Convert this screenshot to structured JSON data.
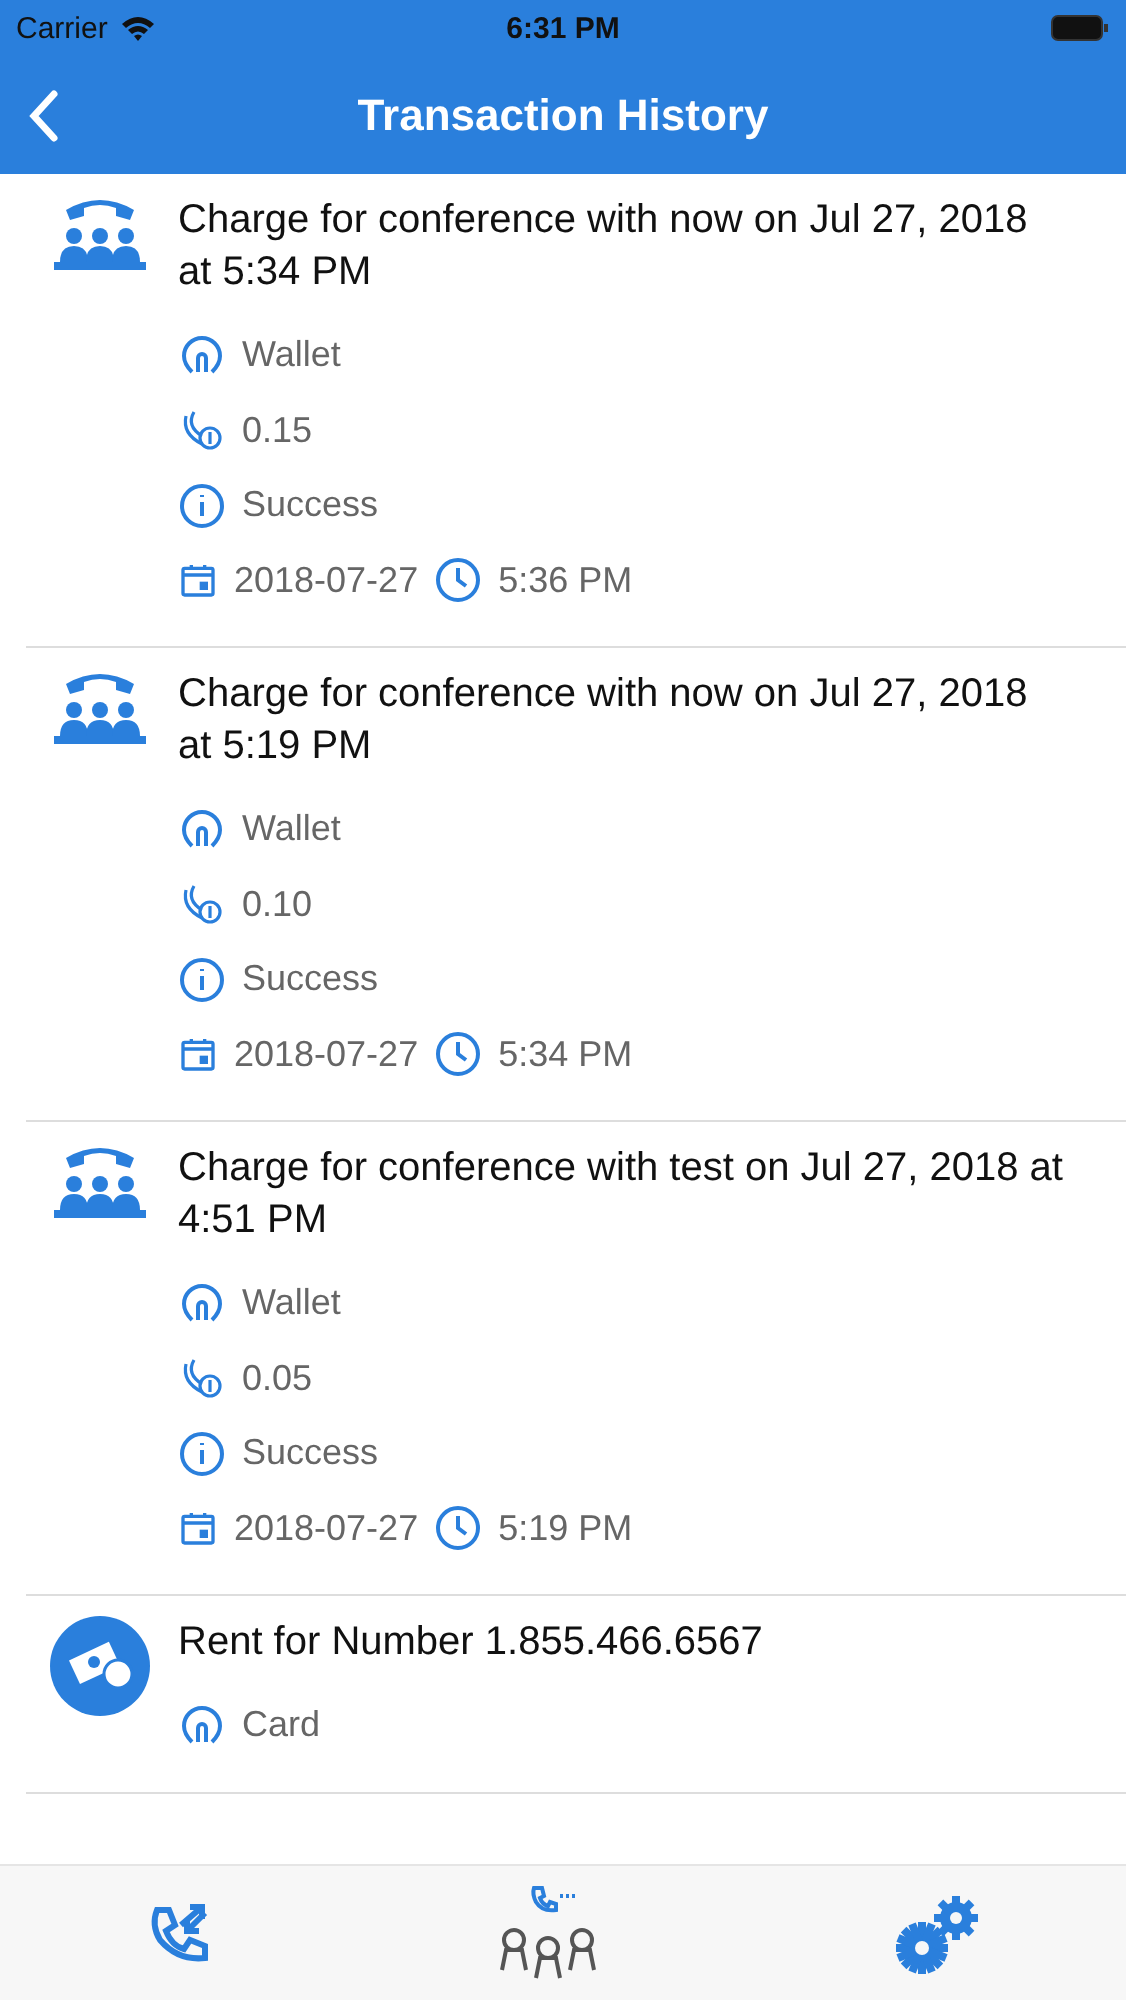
{
  "status_bar": {
    "carrier": "Carrier",
    "time": "6:31 PM"
  },
  "nav": {
    "title": "Transaction History"
  },
  "transactions": [
    {
      "kind": "conference",
      "title": "Charge for conference with now on  Jul 27, 2018 at 5:34 PM",
      "method": "Wallet",
      "amount": "0.15",
      "status": "Success",
      "date": "2018-07-27",
      "time": "5:36 PM"
    },
    {
      "kind": "conference",
      "title": "Charge for conference with now on  Jul 27, 2018 at 5:19 PM",
      "method": "Wallet",
      "amount": "0.10",
      "status": "Success",
      "date": "2018-07-27",
      "time": "5:34 PM"
    },
    {
      "kind": "conference",
      "title": "Charge for conference with test on  Jul 27, 2018 at 4:51 PM",
      "method": "Wallet",
      "amount": "0.05",
      "status": "Success",
      "date": "2018-07-27",
      "time": "5:19 PM"
    },
    {
      "kind": "rent",
      "title": "Rent for Number 1.855.466.6567",
      "method": "Card"
    }
  ],
  "tab_bar": [
    {
      "kind": "calls"
    },
    {
      "kind": "conference"
    },
    {
      "kind": "settings"
    }
  ]
}
